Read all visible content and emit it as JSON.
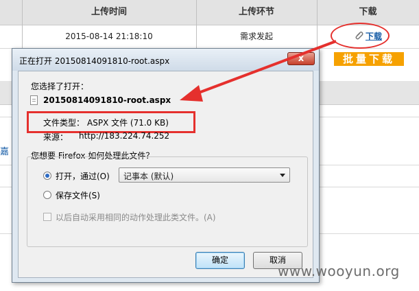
{
  "table": {
    "headers": [
      "",
      "上传时间",
      "上传环节",
      "下载"
    ],
    "row": {
      "upload_time": "2015-08-14 21:18:10",
      "stage": "需求发起",
      "download_label": "下载"
    }
  },
  "batch_download_label": "批量下载",
  "background_side_text": "嘉",
  "dialog": {
    "title": "正在打开 20150814091810-root.aspx",
    "close_label": "x",
    "chosen_label": "您选择了打开：",
    "file_name": "20150814091810-root.aspx",
    "file_type_label": "文件类型：",
    "file_type_value": "ASPX 文件 (71.0 KB)",
    "source_label": "来源：",
    "source_value": "http://183.224.74.252",
    "question": "您想要 Firefox 如何处理此文件？",
    "open_with_label": "打开，通过(O)",
    "open_with_selected": "记事本 (默认)",
    "save_label": "保存文件(S)",
    "auto_label": "以后自动采用相同的动作处理此类文件。(A)",
    "ok_label": "确定",
    "cancel_label": "取消"
  },
  "watermark": "www.wooyun.org",
  "colors": {
    "annotation_red": "#e5302d",
    "batch_button": "#f6a100",
    "link_blue": "#1a5fa8"
  }
}
